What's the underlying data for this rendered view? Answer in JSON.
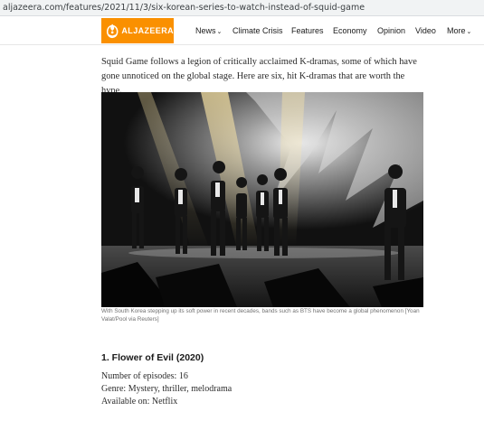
{
  "browser": {
    "url": "aljazeera.com/features/2021/11/3/six-korean-series-to-watch-instead-of-squid-game"
  },
  "header": {
    "logo_text": "ALJAZEERA",
    "brand_color": "#fa9000",
    "nav": [
      {
        "label": "News",
        "has_dropdown": true
      },
      {
        "label": "Climate Crisis",
        "has_dropdown": false
      },
      {
        "label": "Features",
        "has_dropdown": false
      },
      {
        "label": "Economy",
        "has_dropdown": false
      },
      {
        "label": "Opinion",
        "has_dropdown": false
      },
      {
        "label": "Video",
        "has_dropdown": false
      },
      {
        "label": "More",
        "has_dropdown": true
      }
    ],
    "dropdown_icon": "chevron-down-icon"
  },
  "article": {
    "intro": "Squid Game follows a legion of critically acclaimed K-dramas, some of which have gone unnoticed on the global stage. Here are six, hit K-dramas that are worth the hype.",
    "image_caption": "With South Korea stepping up its soft power in recent decades, bands such as BTS have become a global phenomenon [Yoan Valat/Pool via Reuters]",
    "section": {
      "title": "1. Flower of Evil (2020)",
      "episodes": "Number of episodes: 16",
      "genre": "Genre: Mystery, thriller, melodrama",
      "available": "Available on: Netflix"
    }
  }
}
